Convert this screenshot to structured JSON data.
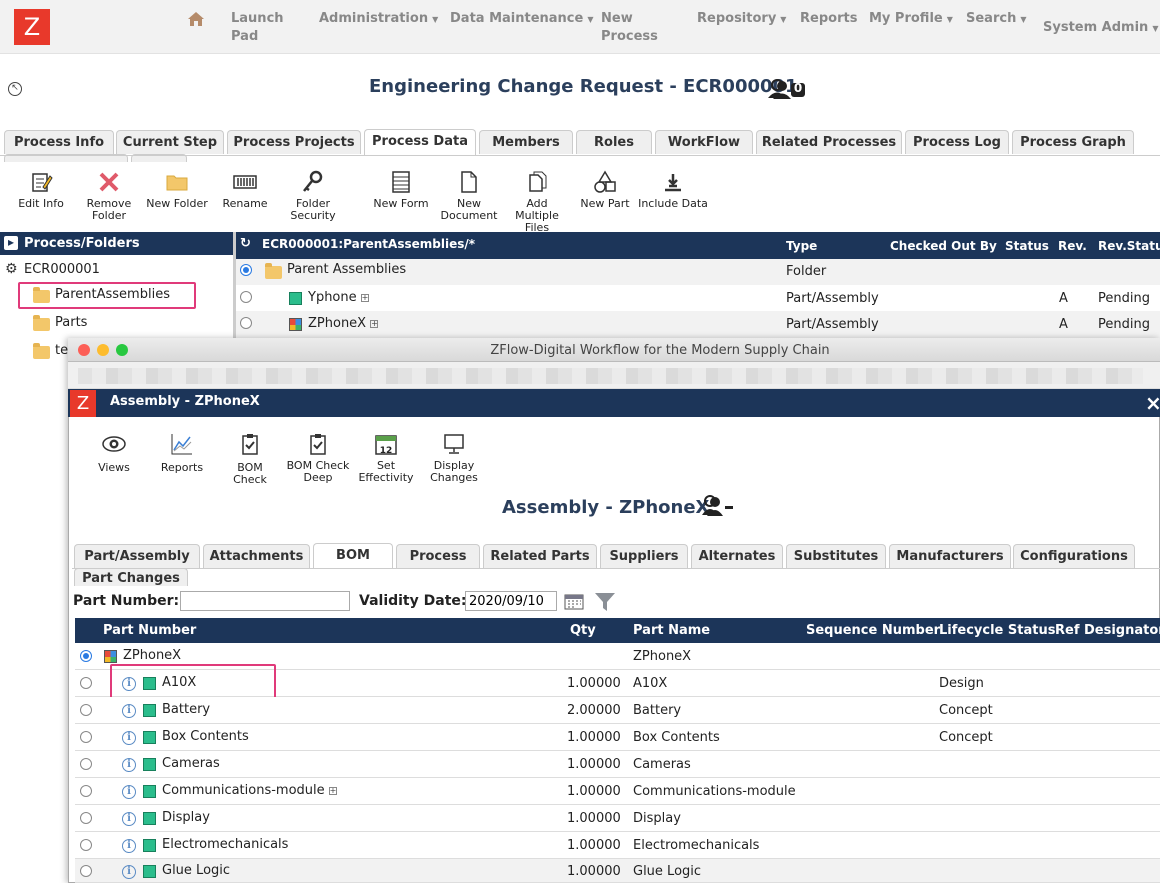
{
  "app": {
    "logo": "Z",
    "nav": {
      "launch_pad": "Launch Pad",
      "administration": "Administration",
      "data_maintenance": "Data Maintenance",
      "new_process": "New Process",
      "repository": "Repository",
      "reports": "Reports",
      "my_profile": "My Profile",
      "search": "Search",
      "user": "System Admin"
    },
    "title": "Engineering Change Request - ECR000001",
    "watchers_count": "0",
    "tabs": [
      "Process Info",
      "Current Step",
      "Process Projects",
      "Process Data",
      "Members",
      "Roles",
      "WorkFlow",
      "Related Processes",
      "Process Log",
      "Process Graph"
    ],
    "active_tab": "Process Data",
    "toolbar": {
      "edit_info": "Edit Info",
      "remove_folder": "Remove Folder",
      "new_folder": "New Folder",
      "rename": "Rename",
      "folder_security": "Folder Security",
      "new_form": "New Form",
      "new_document": "New Document",
      "add_multiple_files": "Add Multiple Files",
      "new_part": "New Part",
      "include_data": "Include Data"
    },
    "folders_panel": {
      "header": "Process/Folders",
      "root": "ECR000001",
      "items": [
        "ParentAssemblies",
        "Parts",
        "te"
      ]
    },
    "content_panel": {
      "path": "ECR000001:ParentAssemblies/*",
      "columns": {
        "type": "Type",
        "checked_out_by": "Checked Out By",
        "status": "Status",
        "rev": "Rev.",
        "rev_status": "Rev.Statu"
      },
      "rows": [
        {
          "name": "Parent Assemblies",
          "type": "Folder",
          "rev": "",
          "rev_status": ""
        },
        {
          "name": "Yphone",
          "type": "Part/Assembly",
          "rev": "A",
          "rev_status": "Pending"
        },
        {
          "name": "ZPhoneX",
          "type": "Part/Assembly",
          "rev": "A",
          "rev_status": "Pending"
        }
      ]
    }
  },
  "popup": {
    "window_title": "ZFlow-Digital Workflow for the Modern Supply Chain",
    "logo": "Z",
    "header_title": "Assembly - ZPhoneX",
    "close": "×",
    "toolbar": {
      "views": "Views",
      "reports": "Reports",
      "bom_check": "BOM Check",
      "bom_check_deep": "BOM Check Deep",
      "set_effectivity": "Set Effectivity",
      "set_effectivity_day": "12",
      "display_changes": "Display Changes"
    },
    "title": "Assembly - ZPhoneX",
    "tabs": [
      "Part/Assembly",
      "Attachments",
      "BOM",
      "Process",
      "Related Parts",
      "Suppliers",
      "Alternates",
      "Substitutes",
      "Manufacturers",
      "Configurations",
      "Part Changes"
    ],
    "active_tab": "BOM",
    "filters": {
      "part_number_label": "Part Number:",
      "part_number_value": "",
      "validity_date_label": "Validity Date:",
      "validity_date_value": "2020/09/10"
    },
    "bom": {
      "columns": {
        "part_number": "Part Number",
        "qty": "Qty",
        "part_name": "Part Name",
        "sequence_number": "Sequence Number",
        "lifecycle_status": "Lifecycle Status",
        "ref_designator": "Ref Designator"
      },
      "rows": [
        {
          "part_number": "ZPhoneX",
          "qty": "",
          "part_name": "ZPhoneX",
          "lifecycle": ""
        },
        {
          "part_number": "A10X",
          "qty": "1.00000",
          "part_name": "A10X",
          "lifecycle": "Design"
        },
        {
          "part_number": "Battery",
          "qty": "2.00000",
          "part_name": "Battery",
          "lifecycle": "Concept"
        },
        {
          "part_number": "Box Contents",
          "qty": "1.00000",
          "part_name": "Box Contents",
          "lifecycle": "Concept"
        },
        {
          "part_number": "Cameras",
          "qty": "1.00000",
          "part_name": "Cameras",
          "lifecycle": ""
        },
        {
          "part_number": "Communications-module",
          "qty": "1.00000",
          "part_name": "Communications-module",
          "lifecycle": ""
        },
        {
          "part_number": "Display",
          "qty": "1.00000",
          "part_name": "Display",
          "lifecycle": ""
        },
        {
          "part_number": "Electromechanicals",
          "qty": "1.00000",
          "part_name": "Electromechanicals",
          "lifecycle": ""
        },
        {
          "part_number": "Glue Logic",
          "qty": "1.00000",
          "part_name": "Glue Logic",
          "lifecycle": ""
        }
      ]
    }
  }
}
